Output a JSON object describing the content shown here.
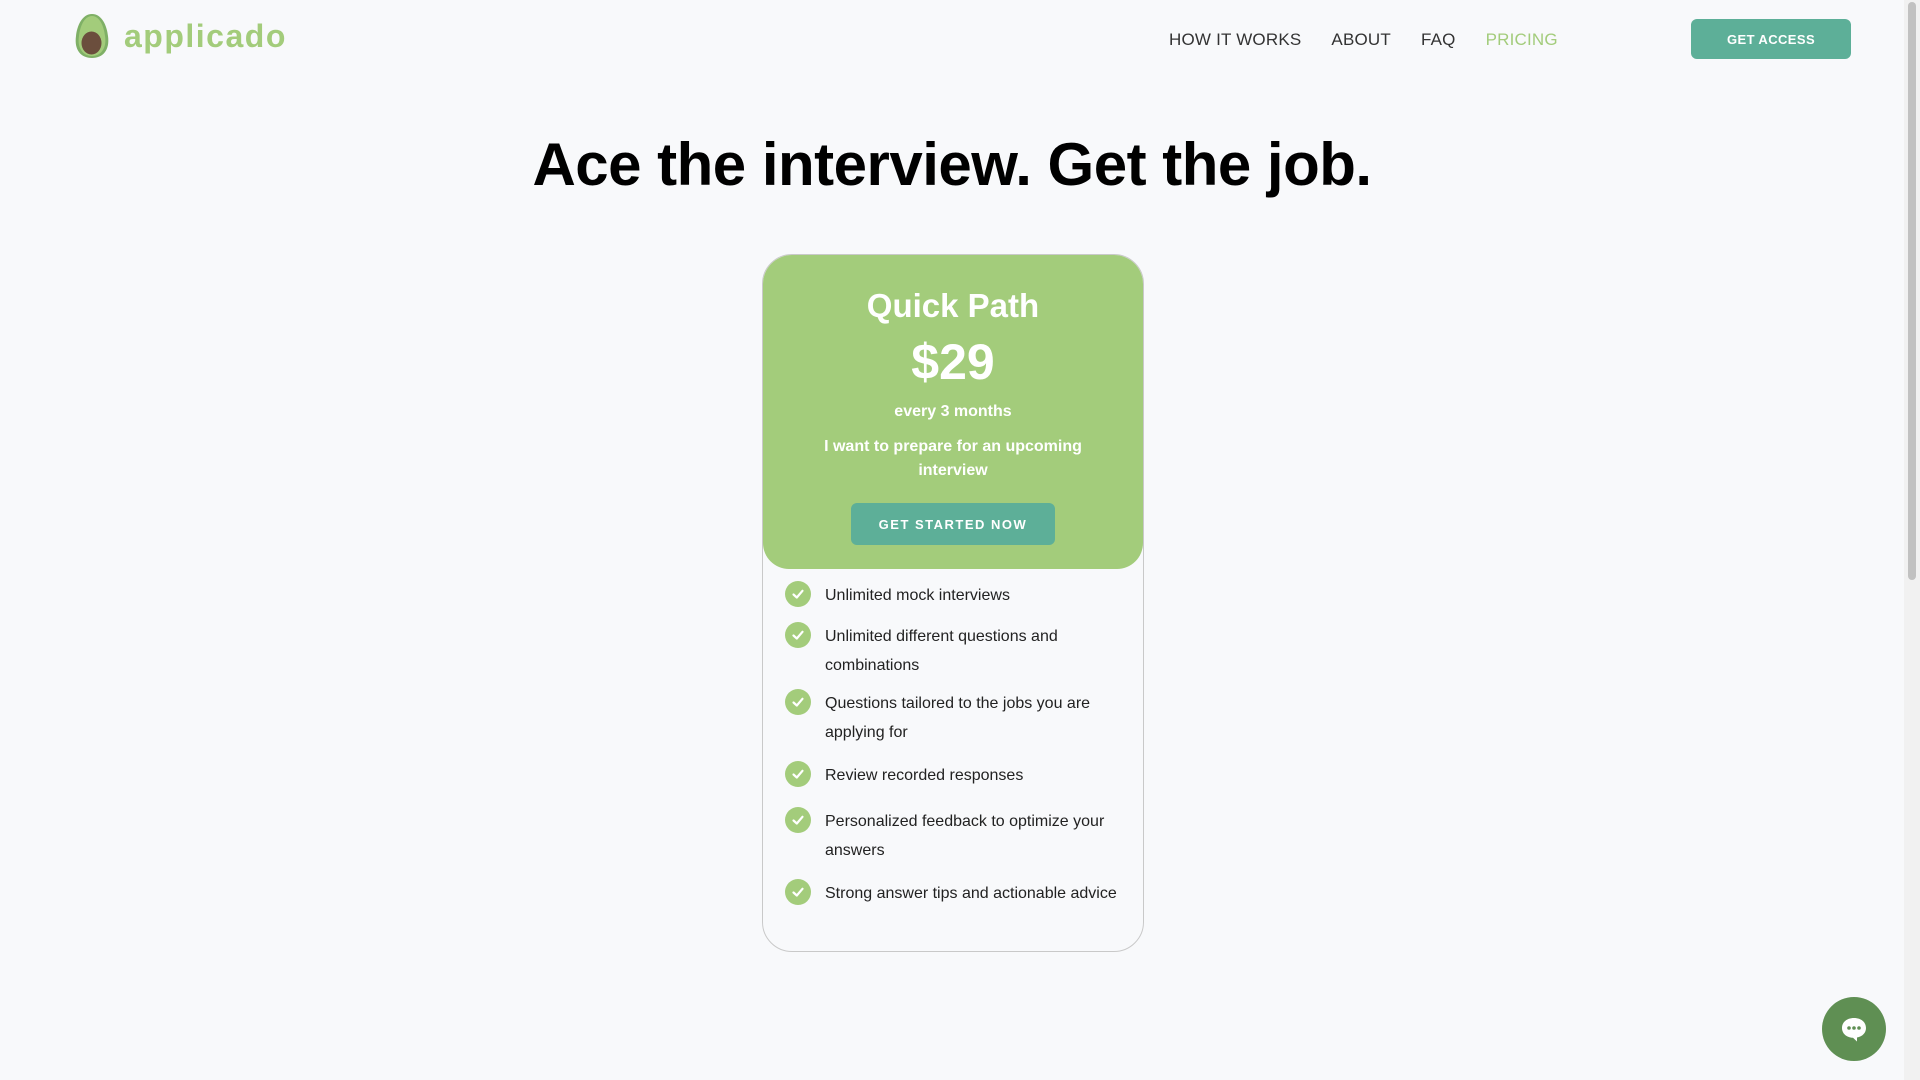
{
  "header": {
    "logo_text": "applicado",
    "nav": [
      {
        "label": "HOW IT WORKS"
      },
      {
        "label": "ABOUT"
      },
      {
        "label": "FAQ"
      },
      {
        "label": "PRICING"
      }
    ],
    "active_nav": "PRICING",
    "cta_label": "GET ACCESS"
  },
  "hero": {
    "title": "Ace the interview. Get the job."
  },
  "plan": {
    "name": "Quick Path",
    "price": "$29",
    "period": "every 3 months",
    "description": "I want to prepare for an upcoming interview",
    "cta_label": "GET STARTED NOW",
    "features": [
      "Unlimited mock interviews",
      "Unlimited different questions and combinations",
      "Questions tailored to the jobs you are applying for",
      "Review recorded responses",
      "Personalized feedback to optimize your answers",
      "Strong answer tips and actionable advice"
    ]
  },
  "icons": {
    "logo": "avocado-icon",
    "check": "check-circle-icon",
    "chat": "chat-icon"
  },
  "colors": {
    "brand_green": "#a3cc7b",
    "button_teal": "#5daf98",
    "chat_green": "#5f8f53",
    "background": "#f8f9fb"
  }
}
